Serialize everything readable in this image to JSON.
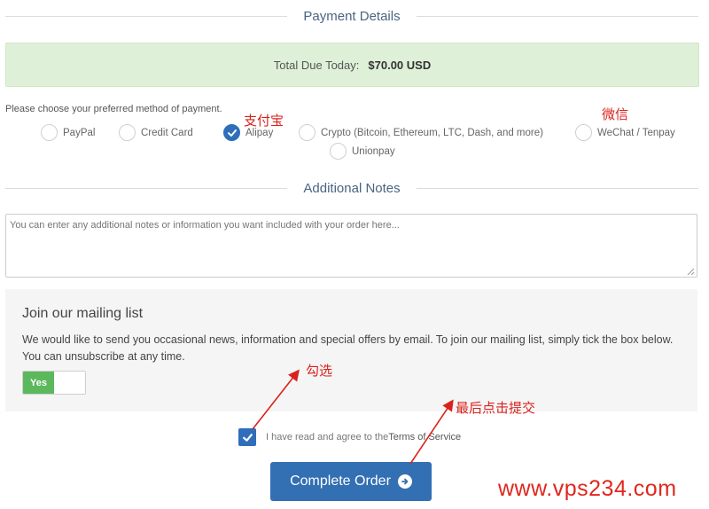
{
  "payment_details": {
    "title": "Payment Details",
    "total_label": "Total Due Today:",
    "total_amount": "$70.00 USD",
    "choose_label": "Please choose your preferred method of payment.",
    "methods": [
      {
        "label": "PayPal",
        "checked": false
      },
      {
        "label": "Credit Card",
        "checked": false
      },
      {
        "label": "Alipay",
        "checked": true
      },
      {
        "label": "Crypto (Bitcoin, Ethereum, LTC, Dash, and more)",
        "checked": false
      },
      {
        "label": "WeChat / Tenpay",
        "checked": false
      },
      {
        "label": "Unionpay",
        "checked": false
      }
    ]
  },
  "additional_notes": {
    "title": "Additional Notes",
    "placeholder": "You can enter any additional notes or information you want included with your order here..."
  },
  "mailing_list": {
    "title": "Join our mailing list",
    "description": "We would like to send you occasional news, information and special offers by email. To join our mailing list, simply tick the box below. You can unsubscribe at any time.",
    "toggle_label": "Yes"
  },
  "terms": {
    "prefix": "I have read and agree to the ",
    "link": "Terms of Service"
  },
  "submit": {
    "label": "Complete Order"
  },
  "annotations": {
    "alipay_note": "支付宝",
    "wechat_note": "微信",
    "tick_note": "勾选",
    "submit_note": "最后点击提交",
    "watermark": "www.vps234.com"
  },
  "colors": {
    "accent_blue": "#336fb3",
    "success_bg": "#dff0d8",
    "toggle_green": "#5cb85c",
    "annotation_red": "#d9221c"
  }
}
